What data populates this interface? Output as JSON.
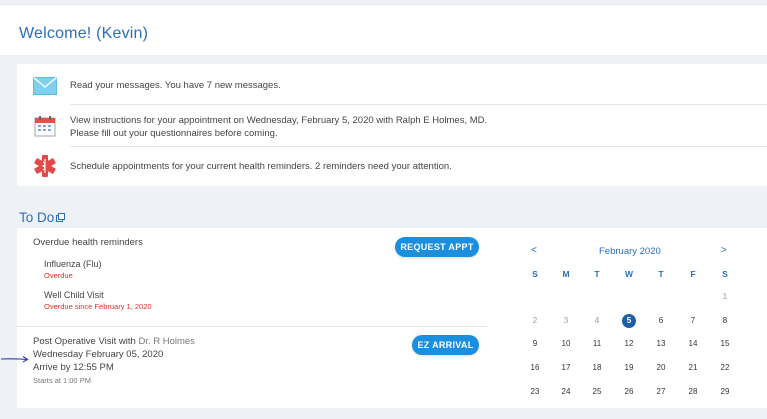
{
  "welcome": {
    "title": "Welcome! (Kevin)"
  },
  "messages": [
    {
      "icon": "envelope-icon",
      "text": "Read your messages. You have 7 new messages."
    },
    {
      "icon": "calendar-icon",
      "line1": "View instructions for your appointment on Wednesday, February 5, 2020 with Ralph E Holmes, MD.",
      "line2": "Please fill out your questionnaires before coming."
    },
    {
      "icon": "medical-star-icon",
      "text": "Schedule appointments for your current health reminders. 2 reminders need your attention."
    }
  ],
  "todo": {
    "title": "To Do",
    "overdue_heading": "Overdue health reminders",
    "request_appt_label": "REQUEST APPT",
    "reminders": [
      {
        "name": "Influenza (Flu)",
        "status": "Overdue"
      },
      {
        "name": "Well Child Visit",
        "status": "Overdue since February 1, 2020"
      }
    ],
    "visit": {
      "title_prefix": "Post Operative Visit with",
      "doctor": "Dr. R Holmes",
      "date": "Wednesday February 05, 2020",
      "arrive": "Arrive by 12:55 PM",
      "starts": "Starts at 1:00 PM",
      "ez_label": "EZ ARRIVAL"
    }
  },
  "calendar": {
    "month": "February 2020",
    "prev": "<",
    "next": ">",
    "dow": [
      "S",
      "M",
      "T",
      "W",
      "T",
      "F",
      "S"
    ],
    "weeks": [
      [
        "",
        "",
        "",
        "",
        "",
        "",
        "1"
      ],
      [
        "2",
        "3",
        "4",
        "5",
        "6",
        "7",
        "8"
      ],
      [
        "9",
        "10",
        "11",
        "12",
        "13",
        "14",
        "15"
      ],
      [
        "16",
        "17",
        "18",
        "19",
        "20",
        "21",
        "22"
      ],
      [
        "23",
        "24",
        "25",
        "26",
        "27",
        "28",
        "29"
      ]
    ],
    "selected": "5"
  },
  "colors": {
    "accent": "#2b6fb5",
    "button": "#1a8fe0",
    "alert": "#d9322b"
  }
}
